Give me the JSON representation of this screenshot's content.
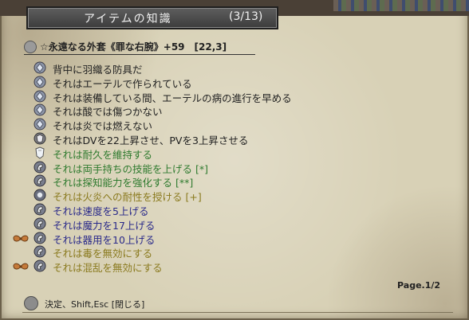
{
  "window": {
    "title": "アイテムの知識",
    "count": "(3/13)"
  },
  "item": {
    "name": "☆永遠なる外套《罪な右腕》+59　[22,3]"
  },
  "properties": [
    {
      "text": "背中に羽織る防具だ",
      "color": "#222222",
      "icon": "gem-icon",
      "badge": ""
    },
    {
      "text": "それはエーテルで作られている",
      "color": "#222222",
      "icon": "gem-icon",
      "badge": ""
    },
    {
      "text": "それは装備している間、エーテルの病の進行を早める",
      "color": "#222222",
      "icon": "gem-icon",
      "badge": ""
    },
    {
      "text": "それは酸では傷つかない",
      "color": "#222222",
      "icon": "gem-icon",
      "badge": ""
    },
    {
      "text": "それは炎では燃えない",
      "color": "#222222",
      "icon": "gem-icon",
      "badge": ""
    },
    {
      "text": "それはDVを22上昇させ、PVを3上昇させる",
      "color": "#222222",
      "icon": "armor-icon",
      "badge": ""
    },
    {
      "text": "それは耐久を維持する",
      "color": "#2e7a2e",
      "icon": "shield-icon",
      "badge": ""
    },
    {
      "text": "それは両手持ちの技能を上げる [*]",
      "color": "#2e7a2e",
      "icon": "hand-icon",
      "badge": ""
    },
    {
      "text": "それは探知能力を強化する [**]",
      "color": "#2e7a2e",
      "icon": "hand-icon",
      "badge": ""
    },
    {
      "text": "それは火炎への耐性を授ける [+]",
      "color": "#8a7a1e",
      "icon": "orb-icon",
      "badge": ""
    },
    {
      "text": "それは速度を5上げる",
      "color": "#2a2a8a",
      "icon": "hand-icon",
      "badge": ""
    },
    {
      "text": "それは魔力を17上げる",
      "color": "#2a2a8a",
      "icon": "hand-icon",
      "badge": ""
    },
    {
      "text": "それは器用を10上げる",
      "color": "#2a2a8a",
      "icon": "hand-icon",
      "badge": "wings-icon"
    },
    {
      "text": "それは毒を無効にする",
      "color": "#8a7a1e",
      "icon": "hand-icon",
      "badge": ""
    },
    {
      "text": "それは混乱を無効にする",
      "color": "#8a7a1e",
      "icon": "hand-icon",
      "badge": "wings-icon"
    }
  ],
  "page_indicator": "Page.1/2",
  "help": "決定、Shift,Esc [閉じる]"
}
